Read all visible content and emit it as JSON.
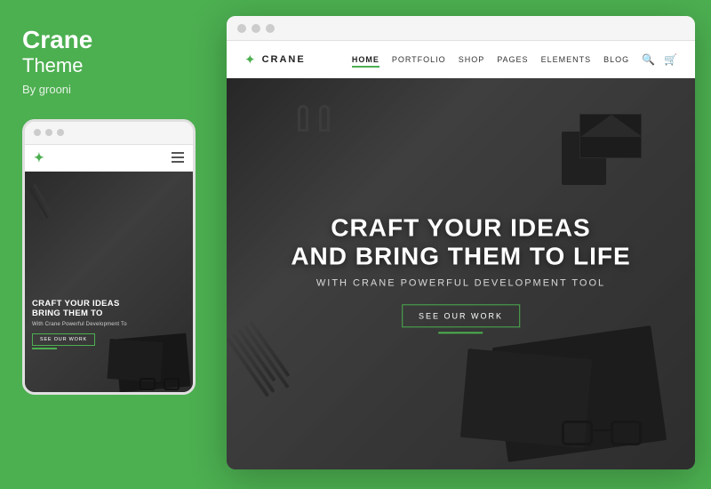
{
  "sidebar": {
    "title": "Crane",
    "subtitle": "Theme",
    "author": "By grooni"
  },
  "mobile_mockup": {
    "dots": [
      "dot1",
      "dot2",
      "dot3"
    ],
    "logo_symbol": "✦",
    "hero_title": "CRAFT YOUR IDEAS\nBRING THEM TO",
    "hero_subtitle": "With Crane Powerful Development To",
    "cta_button": "SEE OUR WORK"
  },
  "desktop_mockup": {
    "dots": [
      "dot1",
      "dot2",
      "dot3"
    ],
    "nav": {
      "logo_symbol": "✦",
      "logo_text": "CRANE",
      "links": [
        {
          "label": "HOME",
          "active": true
        },
        {
          "label": "PORTFOLIO",
          "active": false
        },
        {
          "label": "SHOP",
          "active": false
        },
        {
          "label": "PAGES",
          "active": false
        },
        {
          "label": "ELEMENTS",
          "active": false
        },
        {
          "label": "BLOG",
          "active": false
        }
      ],
      "search_icon": "🔍",
      "cart_icon": "🛒"
    },
    "hero": {
      "main_title": "CRAFT YOUR IDEAS\nAND BRING THEM TO LIFE",
      "subtitle": "With Crane Powerful Development Tool",
      "cta_button": "SEE OUR WORK"
    }
  },
  "colors": {
    "accent": "#4caf50",
    "dark": "#1a1a1a",
    "white": "#ffffff"
  }
}
